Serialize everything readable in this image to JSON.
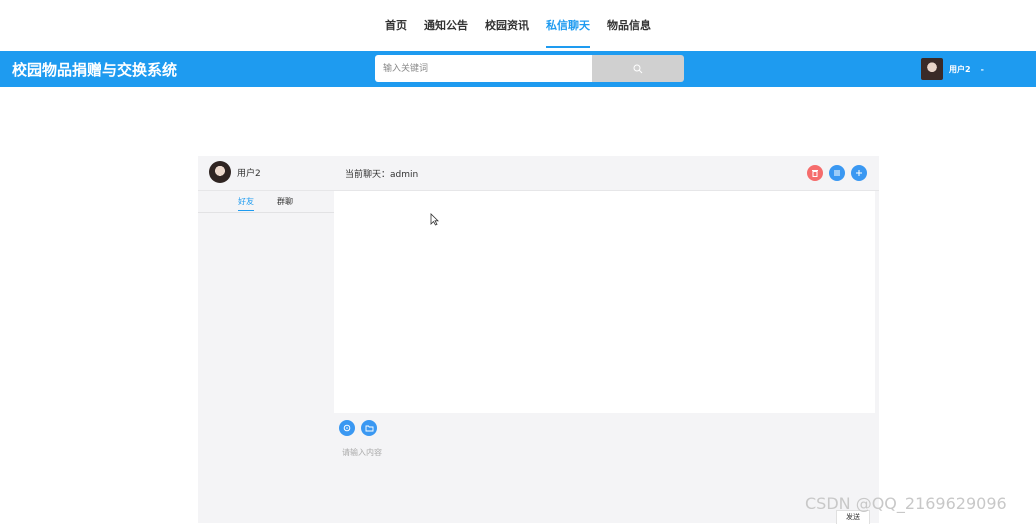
{
  "nav": {
    "items": [
      {
        "label": "首页",
        "active": false
      },
      {
        "label": "通知公告",
        "active": false
      },
      {
        "label": "校园资讯",
        "active": false
      },
      {
        "label": "私信聊天",
        "active": true
      },
      {
        "label": "物品信息",
        "active": false
      }
    ]
  },
  "header": {
    "title": "校园物品捐赠与交换系统",
    "search_placeholder": "输入关键词",
    "user_label": "用户2",
    "dropdown_glyph": "-"
  },
  "chat": {
    "me_name": "用户2",
    "current_chat": "当前聊天：admin",
    "tabs": [
      {
        "label": "好友",
        "active": true
      },
      {
        "label": "群聊",
        "active": false
      }
    ],
    "compose_placeholder": "请输入内容",
    "send_label": "发送"
  },
  "colors": {
    "brand": "#1e9bf0",
    "delete_button": "#f56c6c",
    "action_button": "#3a98f2"
  },
  "icons": {
    "search": "search-icon",
    "delete": "trash-icon",
    "list": "menu-icon",
    "add": "plus-icon",
    "emoji": "emoji-icon",
    "folder": "folder-icon"
  },
  "watermark": "CSDN @QQ_2169629096"
}
